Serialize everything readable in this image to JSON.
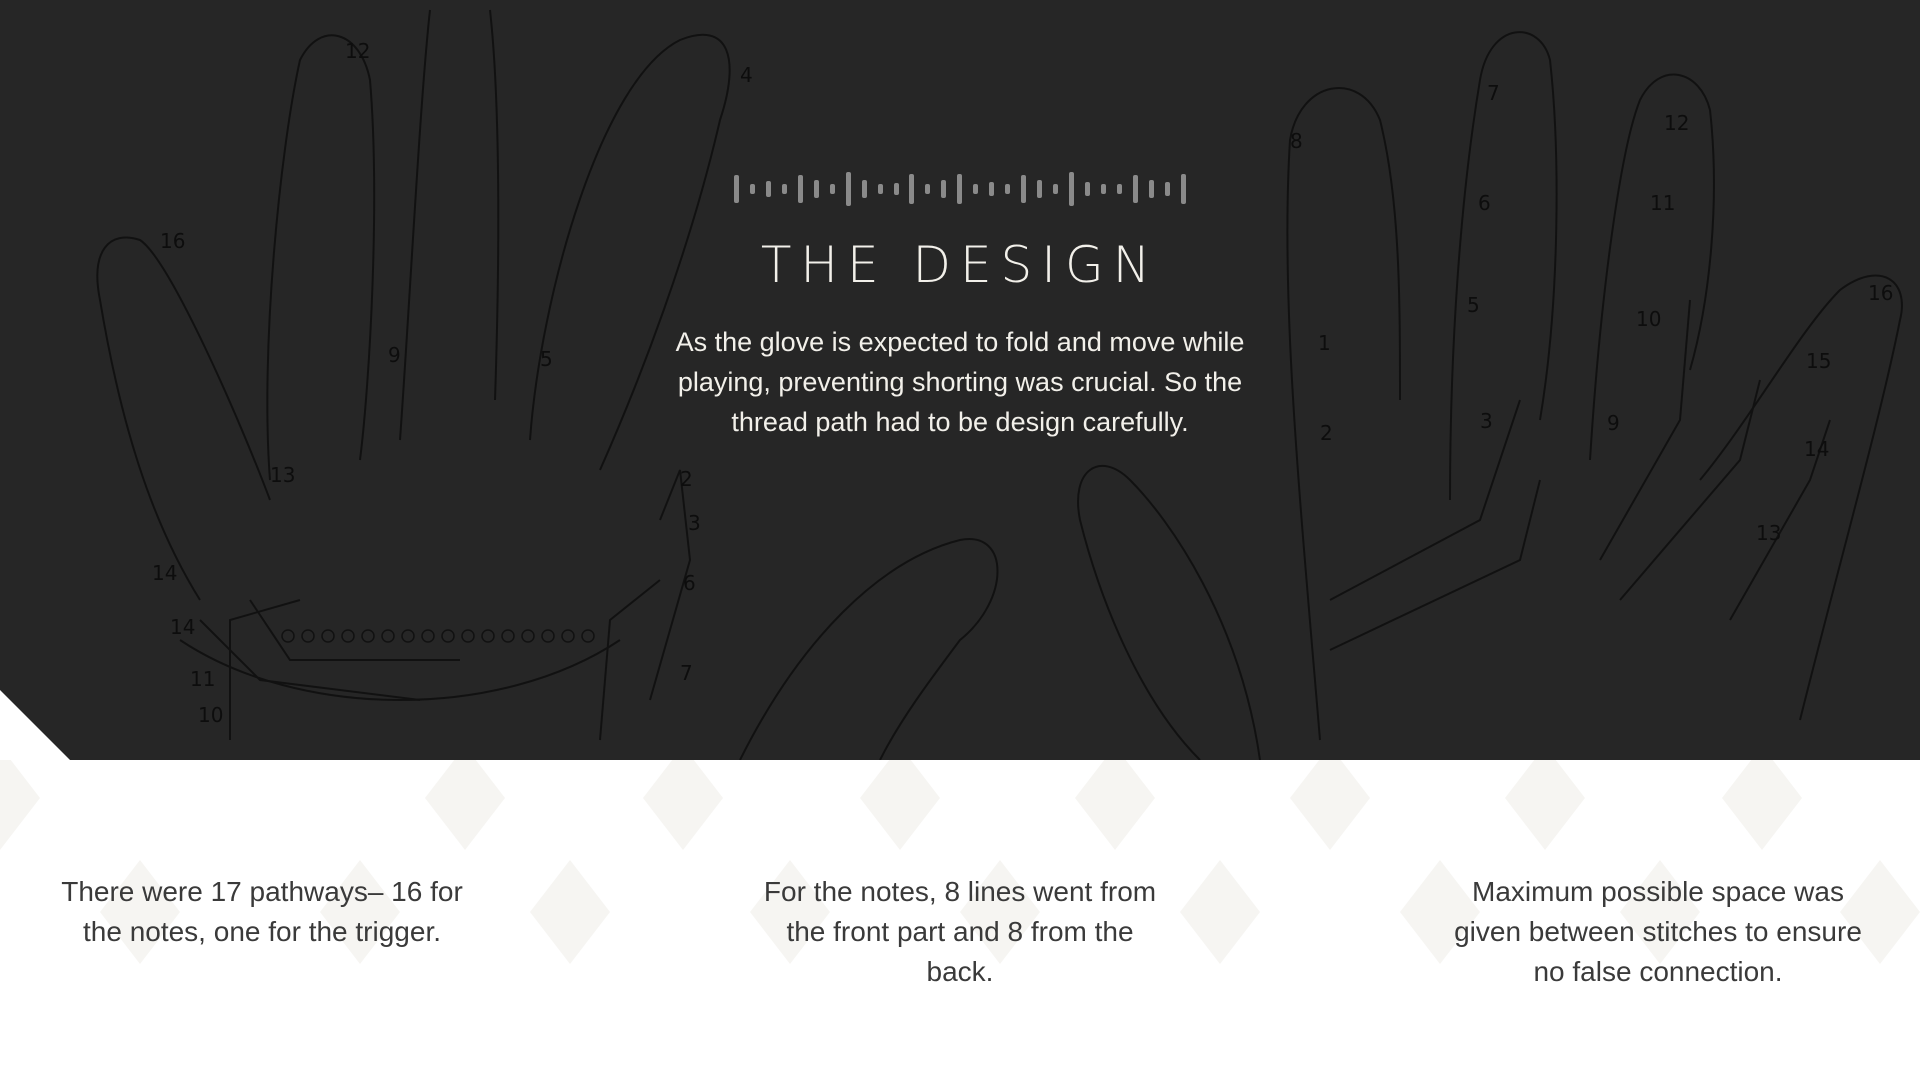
{
  "slide": {
    "title": "THE DESIGN",
    "intro": "As the glove is expected to fold and move while playing, preventing shorting was crucial. So the thread path had to be design carefully.",
    "columns": [
      {
        "text": "There were 17 pathways– 16 for the notes, one for the trigger."
      },
      {
        "text": "For the notes, 8 lines went from the front part and 8 from the back."
      },
      {
        "text": "Maximum possible space was given between stitches to ensure no false connection."
      }
    ],
    "sketch_labels": [
      "12",
      "4",
      "16",
      "13",
      "9",
      "5",
      "2",
      "3",
      "6",
      "7",
      "14",
      "14",
      "11",
      "10",
      "8",
      "7",
      "6",
      "5",
      "3",
      "2",
      "1",
      "12",
      "11",
      "10",
      "9",
      "16",
      "15",
      "14",
      "13"
    ]
  },
  "colors": {
    "hero_background": "#262626",
    "text_light": "#f2f0ea",
    "text_dark": "#3a3a3a",
    "accent_bars": "#8a8a8a"
  }
}
